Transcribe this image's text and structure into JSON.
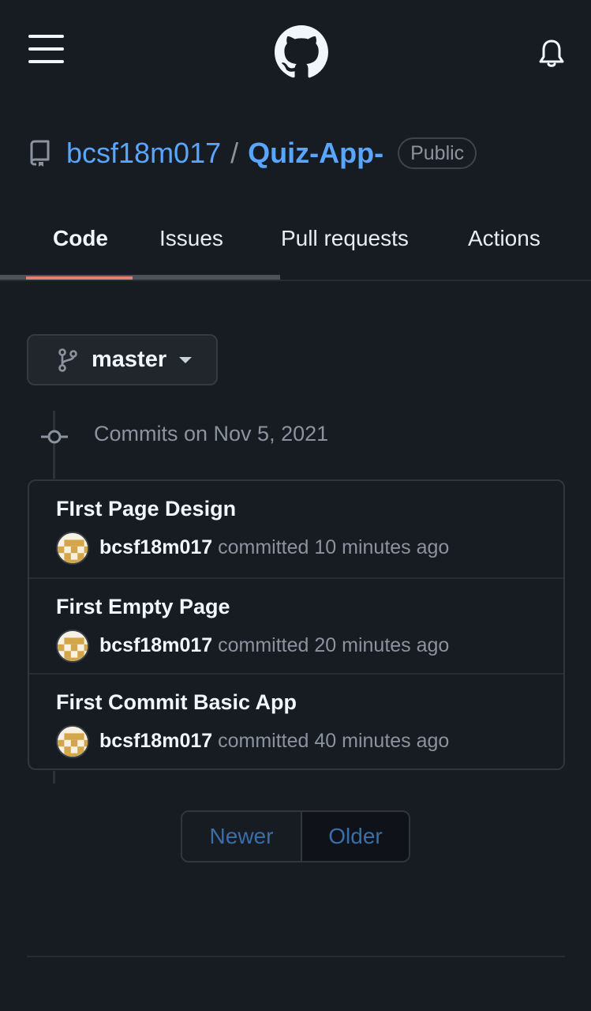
{
  "header": {
    "menu_icon": "hamburger-menu-icon",
    "logo_icon": "github-octocat-icon",
    "notification_icon": "bell-icon"
  },
  "repo": {
    "owner": "bcsf18m017",
    "separator": "/",
    "name": "Quiz-App-",
    "visibility": "Public",
    "icon": "repo-book-icon"
  },
  "tabs": [
    {
      "label": "Code",
      "active": true
    },
    {
      "label": "Issues",
      "active": false
    },
    {
      "label": "Pull requests",
      "active": false
    },
    {
      "label": "Actions",
      "active": false
    }
  ],
  "branch": {
    "label": "master",
    "icon": "git-branch-icon"
  },
  "commits": {
    "header": "Commits on Nov 5, 2021",
    "items": [
      {
        "title": "FIrst Page Design",
        "author": "bcsf18m017",
        "verb": "committed",
        "time": "10 minutes ago"
      },
      {
        "title": "First Empty Page",
        "author": "bcsf18m017",
        "verb": "committed",
        "time": "20 minutes ago"
      },
      {
        "title": "First Commit Basic App",
        "author": "bcsf18m017",
        "verb": "committed",
        "time": "40 minutes ago"
      }
    ]
  },
  "pagination": {
    "newer": "Newer",
    "older": "Older"
  },
  "colors": {
    "background": "#171b22",
    "link": "#58a6ff",
    "tab_underline": "#e0806d",
    "muted": "#8b949e",
    "avatar": "#d4a64a"
  }
}
